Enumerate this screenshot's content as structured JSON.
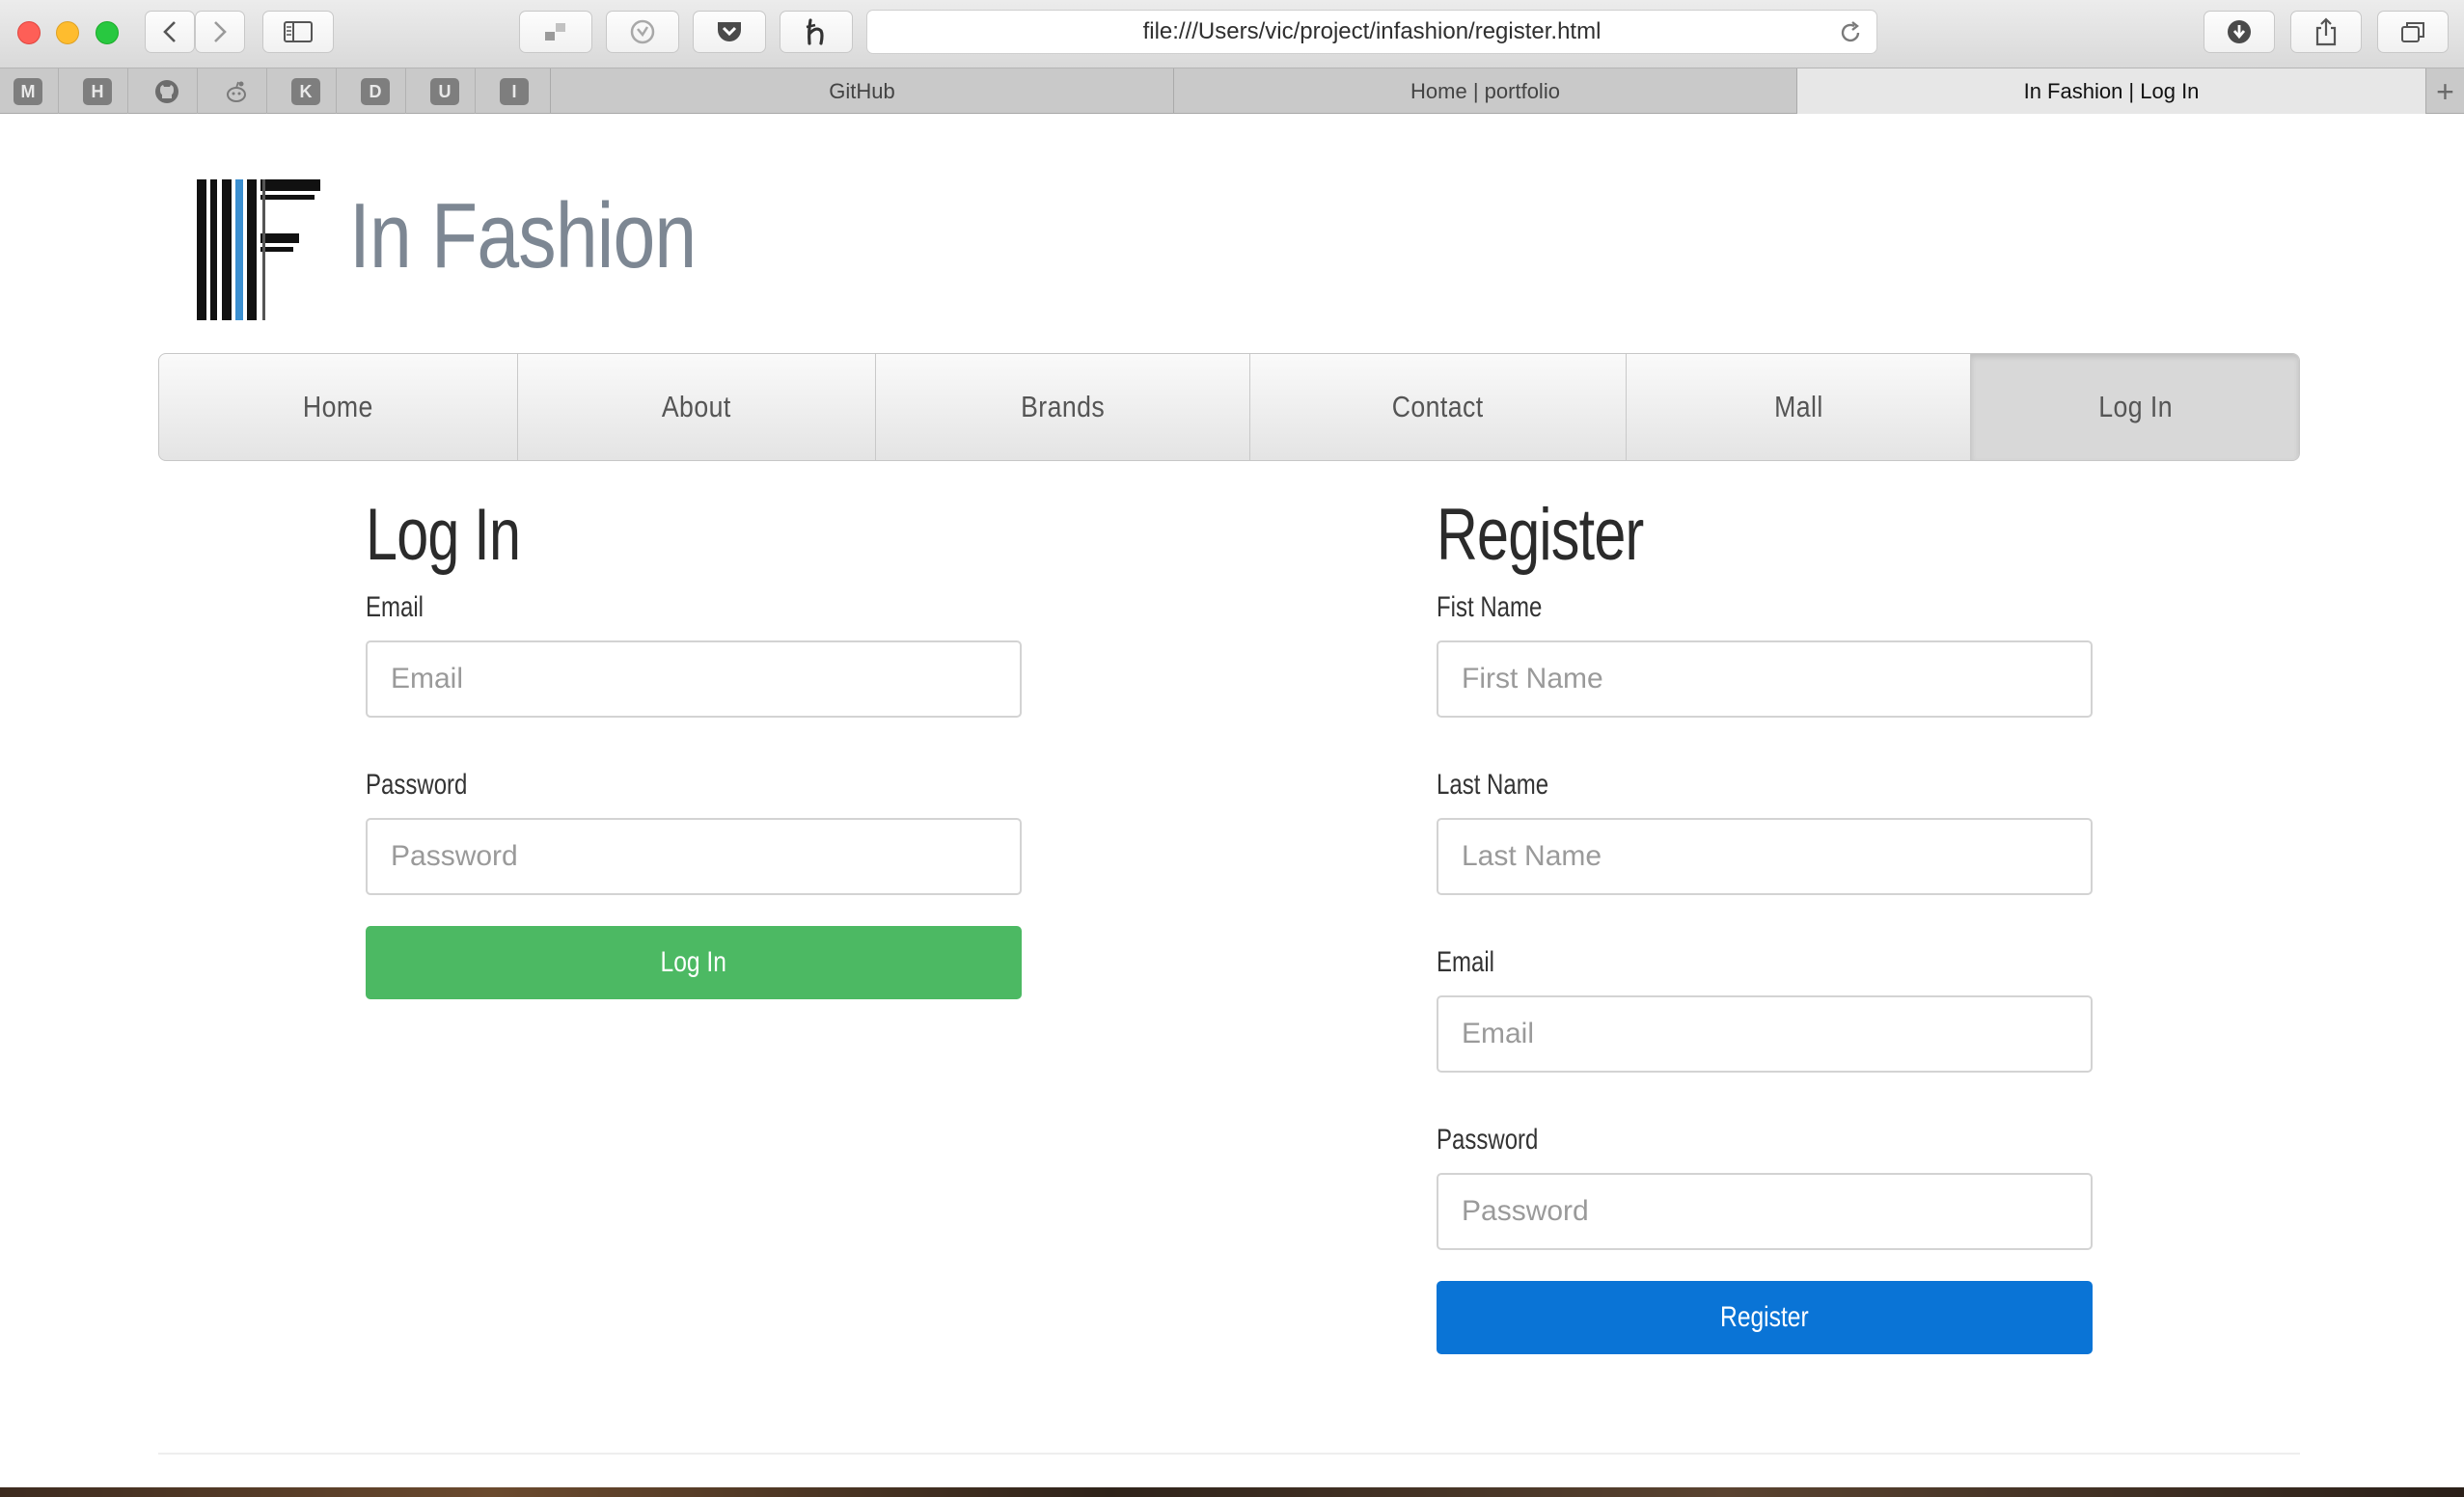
{
  "browser": {
    "url": "file:///Users/vic/project/infashion/register.html",
    "bookmarks": [
      "M",
      "H",
      "K",
      "D",
      "U",
      "I"
    ],
    "tabs": [
      {
        "label": "GitHub",
        "active": false
      },
      {
        "label": "Home | portfolio",
        "active": false
      },
      {
        "label": "In Fashion | Log In",
        "active": true
      }
    ]
  },
  "site": {
    "brand": "In Fashion",
    "nav": [
      "Home",
      "About",
      "Brands",
      "Contact",
      "Mall",
      "Log In"
    ],
    "nav_active": "Log In"
  },
  "login": {
    "title": "Log In",
    "email_label": "Email",
    "email_placeholder": "Email",
    "password_label": "Password",
    "password_placeholder": "Password",
    "button": "Log In",
    "button_color": "#4cb963"
  },
  "register": {
    "title": "Register",
    "first_name_label": "Fist Name",
    "first_name_placeholder": "First Name",
    "last_name_label": "Last Name",
    "last_name_placeholder": "Last Name",
    "email_label": "Email",
    "email_placeholder": "Email",
    "password_label": "Password",
    "password_placeholder": "Password",
    "button": "Register",
    "button_color": "#0a74d6"
  }
}
